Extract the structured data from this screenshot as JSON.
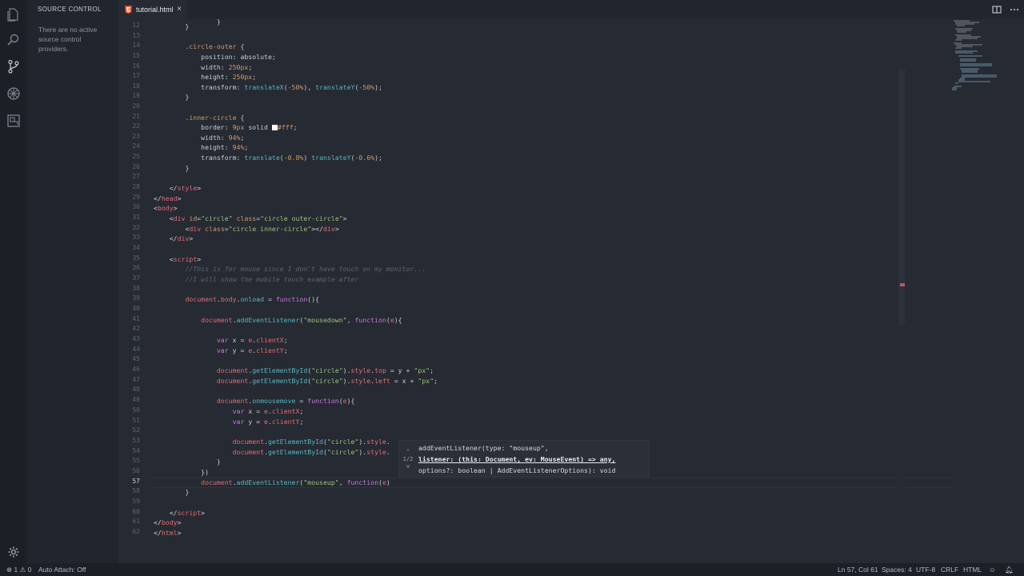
{
  "activity_bar": {
    "icons": [
      "files-icon",
      "search-icon",
      "source-control-icon",
      "debug-icon",
      "extensions-icon",
      "gear-icon"
    ]
  },
  "sidebar": {
    "title": "SOURCE CONTROL",
    "message": "There are no active source control providers."
  },
  "tab": {
    "label": "tutorial.html",
    "close": "×"
  },
  "editor": {
    "line_numbers": [
      "12",
      "13",
      "14",
      "15",
      "16",
      "17",
      "18",
      "19",
      "20",
      "21",
      "22",
      "23",
      "24",
      "25",
      "26",
      "27",
      "28",
      "29",
      "30",
      "31",
      "32",
      "33",
      "34",
      "35",
      "36",
      "37",
      "38",
      "39",
      "40",
      "41",
      "42",
      "43",
      "44",
      "45",
      "46",
      "47",
      "48",
      "49",
      "50",
      "51",
      "52",
      "53",
      "54",
      "55",
      "56",
      "57",
      "58",
      "59",
      "60",
      "61",
      "62"
    ],
    "current_line": "57"
  },
  "hover": {
    "nav_up": "^",
    "counter": "1/2",
    "nav_down": "v",
    "line1": "addEventListener(type: \"mouseup\",",
    "line2_param": "listener: (this: Document, ev: MouseEvent) => any,",
    "line3": "options?: boolean | AddEventListenerOptions): void"
  },
  "status_bar": {
    "errors": "1",
    "warnings": "0",
    "auto_attach": "Auto Attach: Off",
    "position": "Ln 57, Col 61",
    "spaces": "Spaces: 4",
    "encoding": "UTF-8",
    "eol": "CRLF",
    "language": "HTML"
  },
  "colors": {
    "background": "#262a33",
    "sidebar": "#21252d",
    "activity_bar": "#1c1f26",
    "status_bar": "#1c1f26",
    "tag": "#e06c75",
    "attribute": "#d19a66",
    "string": "#98c379",
    "keyword": "#c678dd",
    "function": "#61afef",
    "property": "#56b6c2",
    "comment": "#5c6370"
  }
}
